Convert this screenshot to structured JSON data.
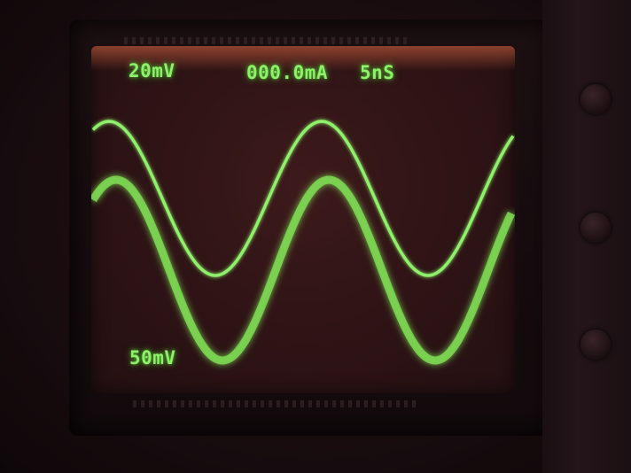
{
  "readouts": {
    "channel1_scale": "20mV",
    "current": "000.0mA",
    "timebase": "5nS",
    "channel2_scale": "50mV"
  },
  "colors": {
    "trace": "#8ff06a",
    "trace_glow": "#4fb832",
    "screen": "#301416"
  },
  "traces": [
    {
      "name": "",
      "color": "#8ff06a"
    },
    {
      "name": "",
      "color": "#7fdc54"
    }
  ]
}
